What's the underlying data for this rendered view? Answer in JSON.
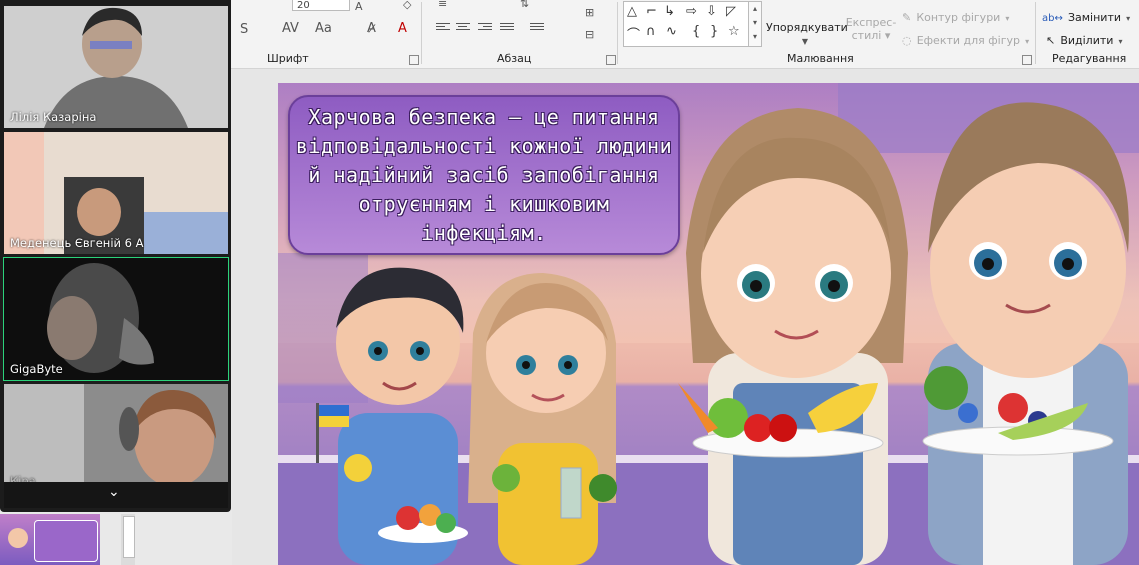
{
  "ribbon": {
    "font_group": "Шрифт",
    "paragraph_group": "Абзац",
    "drawing_group": "Малювання",
    "editing_group": "Редагування",
    "font_size": "20",
    "arrange_label": "Упорядкувати",
    "quick_styles_label_1": "Експрес-",
    "quick_styles_label_2": "стилі",
    "shape_outline_label": "Контур фігури",
    "shape_effects_label": "Ефекти для фігур",
    "replace_label": "Замінити",
    "select_label": "Виділити"
  },
  "slide": {
    "speech_text": "Харчова безпека — це питання відповідальності кожної людини й надійний засіб запобігання отруєнням і кишковим інфекціям."
  },
  "participants": [
    {
      "name": "Лілія Казаріна",
      "active": false
    },
    {
      "name": "Меденець Євгеній 6 А",
      "active": false
    },
    {
      "name": "GigaByte",
      "active": true
    },
    {
      "name": "Кіра",
      "active": false
    }
  ],
  "colors": {
    "active_border": "#2bd27a",
    "speech_bubble": "#8e5cc2"
  }
}
